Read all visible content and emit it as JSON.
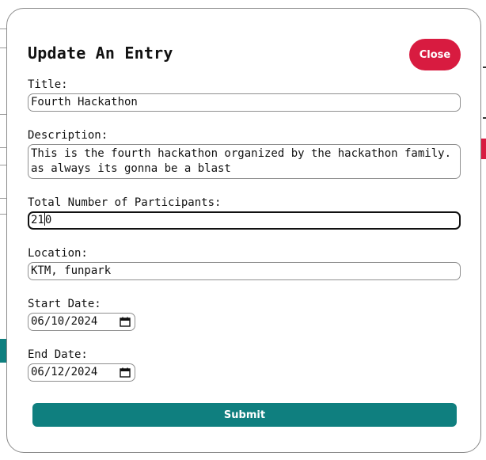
{
  "modal": {
    "title": "Update An Entry",
    "close_label": "Close",
    "submit_label": "Submit"
  },
  "fields": {
    "title": {
      "label": "Title:",
      "value": "Fourth Hackathon"
    },
    "description": {
      "label": "Description:",
      "value": "This is the fourth hackathon organized by the hackathon family. as always its gonna be a blast"
    },
    "participants": {
      "label": "Total Number of Participants:",
      "value_before_caret": "21",
      "value_after_caret": "0"
    },
    "location": {
      "label": "Location:",
      "value": "KTM, funpark"
    },
    "start_date": {
      "label": "Start Date:",
      "value": "06/10/2024"
    },
    "end_date": {
      "label": "End Date:",
      "value": "06/12/2024"
    }
  },
  "icons": {
    "calendar": "calendar-icon"
  },
  "colors": {
    "close_button": "#d81b40",
    "submit_button": "#0f7f7f"
  }
}
